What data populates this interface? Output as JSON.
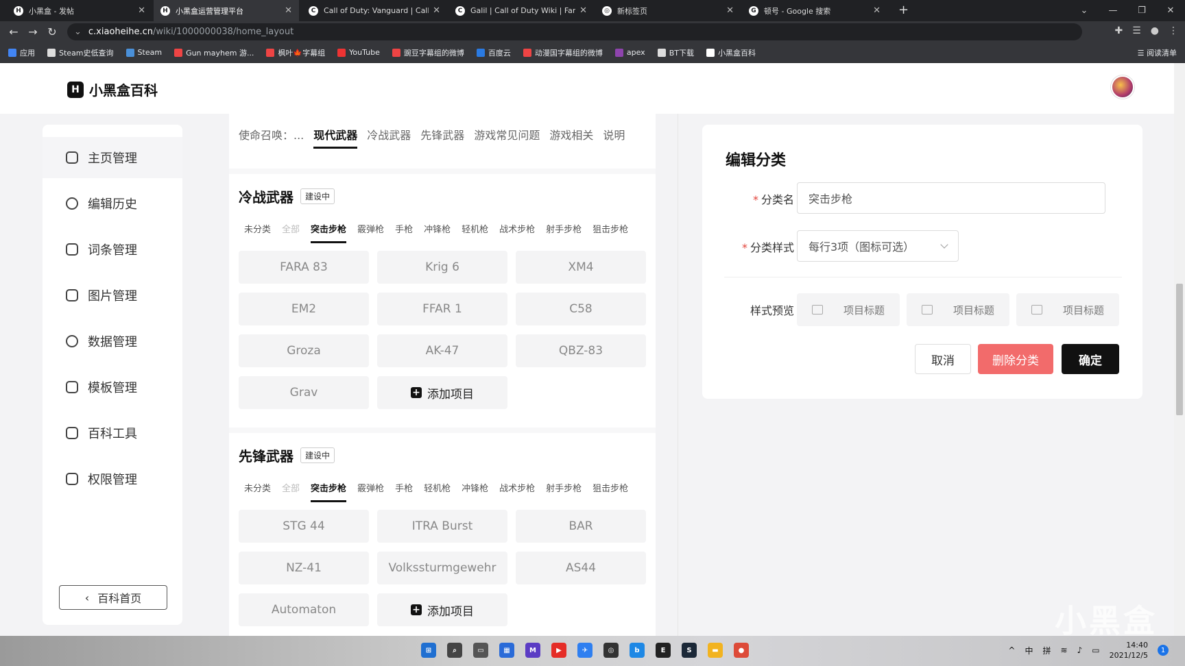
{
  "browser": {
    "tabs": [
      {
        "fav": "H",
        "title": "小黑盒 - 发帖",
        "active": false
      },
      {
        "fav": "H",
        "title": "小黑盒运营管理平台",
        "active": true
      },
      {
        "fav": "C",
        "title": "Call of Duty: Vanguard | Call o",
        "active": false
      },
      {
        "fav": "C",
        "title": "Galil | Call of Duty Wiki | Fand",
        "active": false
      },
      {
        "fav": "◎",
        "title": "新标签页",
        "active": false
      },
      {
        "fav": "G",
        "title": "顿号 - Google 搜索",
        "active": false
      }
    ],
    "url_host": "c.xiaoheihe.cn",
    "url_path": "/wiki/1000000038/home_layout",
    "bookmarks": [
      "应用",
      "Steam史低查询",
      "Steam",
      "Gun mayhem 游...",
      "枫叶🍁字幕组",
      "YouTube",
      "豌豆字幕组的微博",
      "百度云",
      "动漫国字幕组的微博",
      "apex",
      "BT下载",
      "小黑盒百科"
    ],
    "reading_list": "阅读清单"
  },
  "header": {
    "logo_text": "小黑盒百科"
  },
  "sidebar": {
    "items": [
      {
        "label": "主页管理",
        "active": true
      },
      {
        "label": "编辑历史",
        "active": false
      },
      {
        "label": "词条管理",
        "active": false
      },
      {
        "label": "图片管理",
        "active": false
      },
      {
        "label": "数据管理",
        "active": false
      },
      {
        "label": "模板管理",
        "active": false
      },
      {
        "label": "百科工具",
        "active": false
      },
      {
        "label": "权限管理",
        "active": false
      }
    ],
    "home_button": "百科首页"
  },
  "main": {
    "topnav": {
      "prefix": "使命召唤：...",
      "tabs": [
        "现代武器",
        "冷战武器",
        "先锋武器",
        "游戏常见问题",
        "游戏相关",
        "说明"
      ],
      "selected": "现代武器"
    },
    "sections": [
      {
        "title": "冷战武器",
        "badge": "建设中",
        "subtabs": [
          "未分类",
          "全部",
          "突击步枪",
          "霰弹枪",
          "手枪",
          "冲锋枪",
          "轻机枪",
          "战术步枪",
          "射手步枪",
          "狙击步枪"
        ],
        "active_subtab": "突击步枪",
        "items": [
          "FARA 83",
          "Krig 6",
          "XM4",
          "EM2",
          "FFAR 1",
          "C58",
          "Groza",
          "AK-47",
          "QBZ-83",
          "Grav"
        ],
        "add_label": "添加项目"
      },
      {
        "title": "先锋武器",
        "badge": "建设中",
        "subtabs": [
          "未分类",
          "全部",
          "突击步枪",
          "霰弹枪",
          "手枪",
          "轻机枪",
          "冲锋枪",
          "战术步枪",
          "射手步枪",
          "狙击步枪"
        ],
        "active_subtab": "突击步枪",
        "items": [
          "STG 44",
          "ITRA Burst",
          "BAR",
          "NZ-41",
          "Volkssturmgewehr",
          "AS44",
          "Automaton"
        ],
        "add_label": "添加项目"
      }
    ]
  },
  "panel": {
    "title": "编辑分类",
    "name_label": "分类名",
    "name_value": "突击步枪",
    "style_label": "分类样式",
    "style_value": "每行3项（图标可选）",
    "preview_label": "样式预览",
    "preview_item": "项目标题",
    "cancel": "取消",
    "delete": "删除分类",
    "confirm": "确定"
  },
  "watermark": "小黑盒",
  "taskbar": {
    "icons": [
      {
        "name": "windows-start-icon",
        "color": "#1f6fd1",
        "glyph": "⊞"
      },
      {
        "name": "search-icon",
        "color": "#444",
        "glyph": "⌕"
      },
      {
        "name": "task-view-icon",
        "color": "#555",
        "glyph": "▭"
      },
      {
        "name": "widgets-icon",
        "color": "#2a6bd8",
        "glyph": "▦"
      },
      {
        "name": "visual-studio-icon",
        "color": "#5b3cc4",
        "glyph": "M"
      },
      {
        "name": "youtube-icon",
        "color": "#e52d27",
        "glyph": "▶"
      },
      {
        "name": "messenger-icon",
        "color": "#2f7ff0",
        "glyph": "✈"
      },
      {
        "name": "browser-icon",
        "color": "#333",
        "glyph": "◎"
      },
      {
        "name": "bing-icon",
        "color": "#1e88e5",
        "glyph": "b"
      },
      {
        "name": "epic-games-icon",
        "color": "#222",
        "glyph": "E"
      },
      {
        "name": "steam-icon",
        "color": "#1b2838",
        "glyph": "S"
      },
      {
        "name": "file-explorer-icon",
        "color": "#f2b320",
        "glyph": "▬"
      },
      {
        "name": "chrome-icon",
        "color": "#dd4b39",
        "glyph": "●"
      }
    ],
    "ime": [
      "中",
      "拼"
    ],
    "time": "14:40",
    "date": "2021/12/5",
    "notifications": "1"
  }
}
